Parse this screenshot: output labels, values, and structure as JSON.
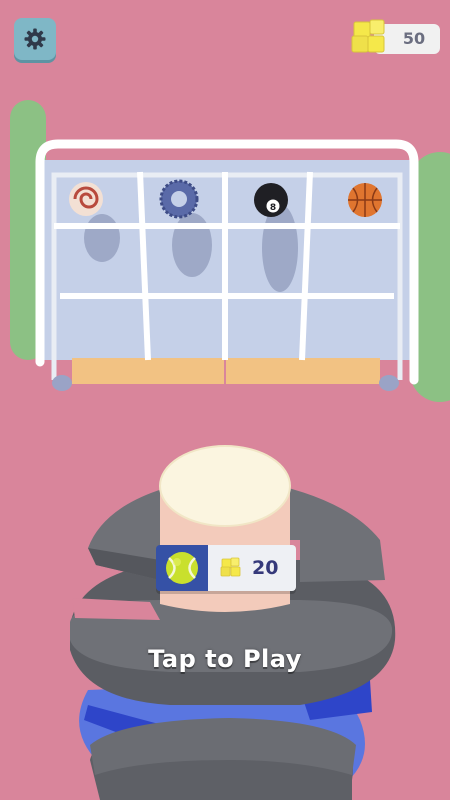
{
  "hud": {
    "settings_icon": "gear-icon",
    "currency_icon": "yellow-cubes-icon",
    "currency_amount": "50"
  },
  "shelf": {
    "balls": [
      "peppermint-candy",
      "tire",
      "eight-ball",
      "basketball"
    ],
    "eight_ball_number": "8"
  },
  "offer": {
    "ball": "tennis-ball",
    "currency_icon": "yellow-cubes-icon",
    "cost": "20"
  },
  "prompt": "Tap to Play",
  "colors": {
    "background": "#d9859b",
    "settings_button": "#7fb7c6",
    "currency_cubes": "#f5e84a",
    "offer_panel": "#3551a6"
  }
}
